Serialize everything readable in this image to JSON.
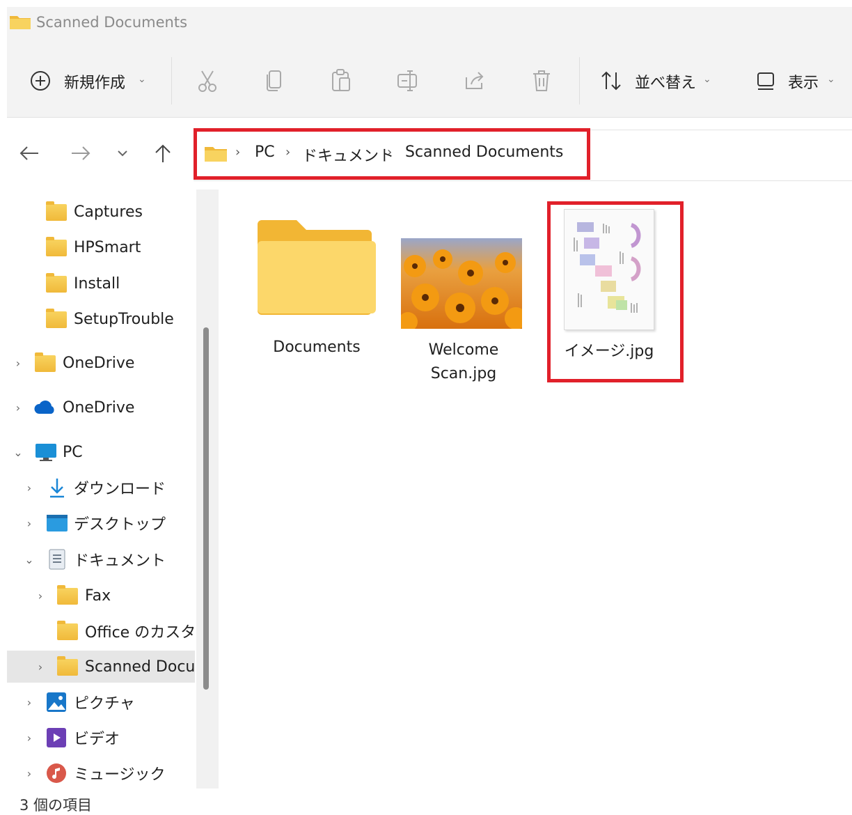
{
  "window": {
    "title": "Scanned Documents"
  },
  "toolbar": {
    "new_label": "新規作成",
    "sort_label": "並べ替え",
    "view_label": "表示",
    "icons": [
      "add-circle-icon",
      "cut-icon",
      "copy-icon",
      "paste-icon",
      "rename-icon",
      "share-icon",
      "delete-icon",
      "sort-icon",
      "view-icon"
    ]
  },
  "navigation": {
    "icons": [
      "back-arrow-icon",
      "forward-arrow-icon",
      "recent-dropdown-icon",
      "up-arrow-icon"
    ]
  },
  "breadcrumb": {
    "items": [
      "PC",
      "ドキュメント",
      "Scanned Documents"
    ],
    "separator": "›"
  },
  "sidebar": {
    "items": [
      {
        "label": "Captures"
      },
      {
        "label": "HPSmart"
      },
      {
        "label": "Install"
      },
      {
        "label": "SetupTrouble"
      },
      {
        "label": "OneDrive"
      },
      {
        "label": "OneDrive"
      },
      {
        "label": "PC"
      },
      {
        "label": "ダウンロード"
      },
      {
        "label": "デスクトップ"
      },
      {
        "label": "ドキュメント"
      },
      {
        "label": "Fax"
      },
      {
        "label": "Office のカスタム"
      },
      {
        "label": "Scanned Docu"
      },
      {
        "label": "ピクチャ"
      },
      {
        "label": "ビデオ"
      },
      {
        "label": "ミュージック"
      }
    ],
    "selected": "Scanned Docu"
  },
  "files": [
    {
      "name": "Documents",
      "type": "folder"
    },
    {
      "name_line1": "Welcome",
      "name_line2": "Scan.jpg",
      "type": "image"
    },
    {
      "name": "イメージ.jpg",
      "type": "image"
    }
  ],
  "status": {
    "item_count": "3 個の項目"
  },
  "colors": {
    "highlight": "#e1202a",
    "folder": "#f5c542",
    "accent": "#0067c0"
  }
}
